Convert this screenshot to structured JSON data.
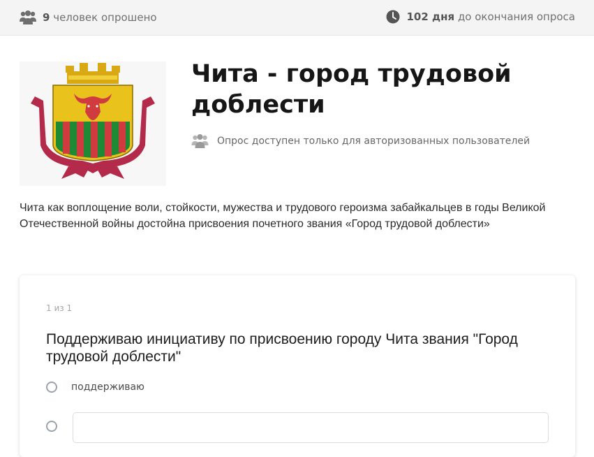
{
  "topbar": {
    "respondents_count": "9",
    "respondents_text": "человек опрошено",
    "days_count": "102 дня",
    "days_text": "до окончания опроса",
    "people_icon": "people-icon",
    "clock_icon": "clock-icon"
  },
  "poll": {
    "title": "Чита - город трудовой доблести",
    "access_note": "Опрос доступен только для авторизованных пользователей",
    "description": "Чита как воплощение воли, стойкости, мужества и трудового героизма забайкальцев в годы Великой Отечественной войны достойна присвоения почетного звания «Город трудовой доблести»",
    "emblem": "chita-coat-of-arms"
  },
  "question": {
    "counter": "1 из 1",
    "text": "Поддерживаю инициативу по присвоению городу Чита звания \"Город трудовой доблести\"",
    "options": [
      {
        "label": "поддерживаю",
        "selected": false
      },
      {
        "label": "",
        "type": "other-text",
        "value": "",
        "selected": false
      }
    ]
  },
  "colors": {
    "topbar_bg": "#f4f4f4",
    "emblem_gold": "#e9c21c",
    "emblem_red": "#cf3b3e",
    "emblem_green": "#1f8a36",
    "ribbon": "#b32a4a"
  }
}
